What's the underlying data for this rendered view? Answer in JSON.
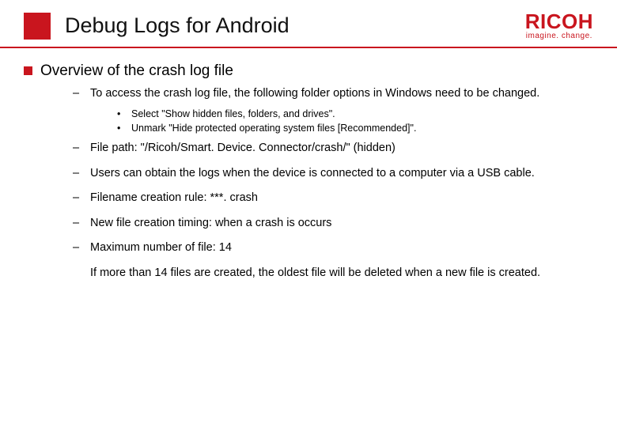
{
  "header": {
    "title": "Debug Logs for Android",
    "logo_text": "RICOH",
    "tagline": "imagine. change."
  },
  "section": {
    "title": "Overview of the crash log file"
  },
  "items": {
    "access": "To access the crash log file, the following folder options in Windows need to be changed.",
    "opt1": "Select \"Show hidden files, folders, and drives\".",
    "opt2": "Unmark \"Hide protected operating system files [Recommended]\".",
    "filepath": "File path: \"/Ricoh/Smart. Device. Connector/crash/\" (hidden)",
    "usb": "Users can obtain the logs when the device is connected to a computer via a USB cable.",
    "filename_rule": "Filename creation rule: ***. crash",
    "timing": "New file creation timing: when a crash is occurs",
    "max": "Maximum number of file: 14",
    "note": "If more than 14 files are created, the oldest file will be deleted when a new file is created."
  }
}
